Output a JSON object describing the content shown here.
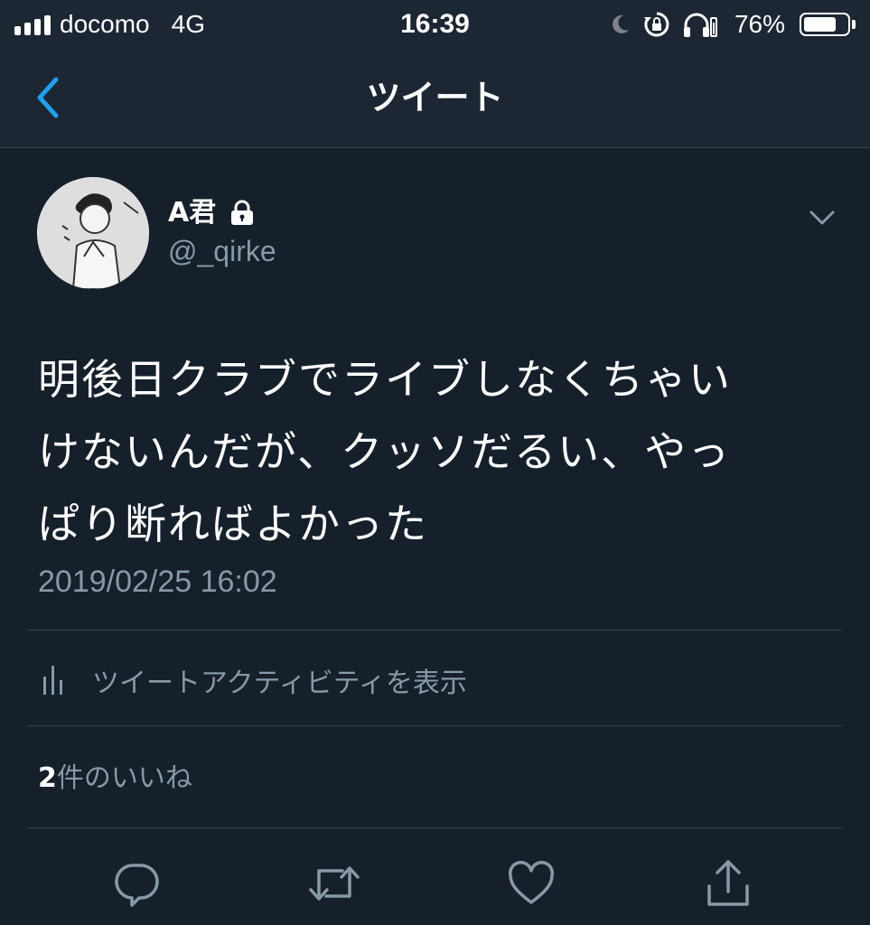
{
  "status_bar": {
    "carrier": "docomo",
    "network": "4G",
    "time": "16:39",
    "battery_percent": "76%",
    "battery_level": 0.76,
    "icons": [
      "signal-icon",
      "moon-icon",
      "rotation-lock-icon",
      "headphones-icon",
      "battery-icon"
    ]
  },
  "nav": {
    "title": "ツイート",
    "back_icon": "chevron-left-icon"
  },
  "tweet": {
    "author_name": "A君",
    "protected_icon": "lock-icon",
    "handle": "@_qirke",
    "text_lines": [
      "明後日クラブでライブしなくちゃい",
      "けないんだが、クッソだるい、やっ",
      "ぱり断ればよかった"
    ],
    "timestamp": "2019/02/25 16:02"
  },
  "activity": {
    "icon": "bar-chart-icon",
    "label": "ツイートアクティビティを表示"
  },
  "likes": {
    "count": "2",
    "label": "件のいいね"
  },
  "actions": [
    "reply-icon",
    "retweet-icon",
    "like-icon",
    "share-icon"
  ],
  "colors": {
    "background": "#15202b",
    "bar_background": "#1c2733",
    "accent": "#1da1f2",
    "secondary_text": "#8899a6",
    "divider": "#38444d"
  }
}
